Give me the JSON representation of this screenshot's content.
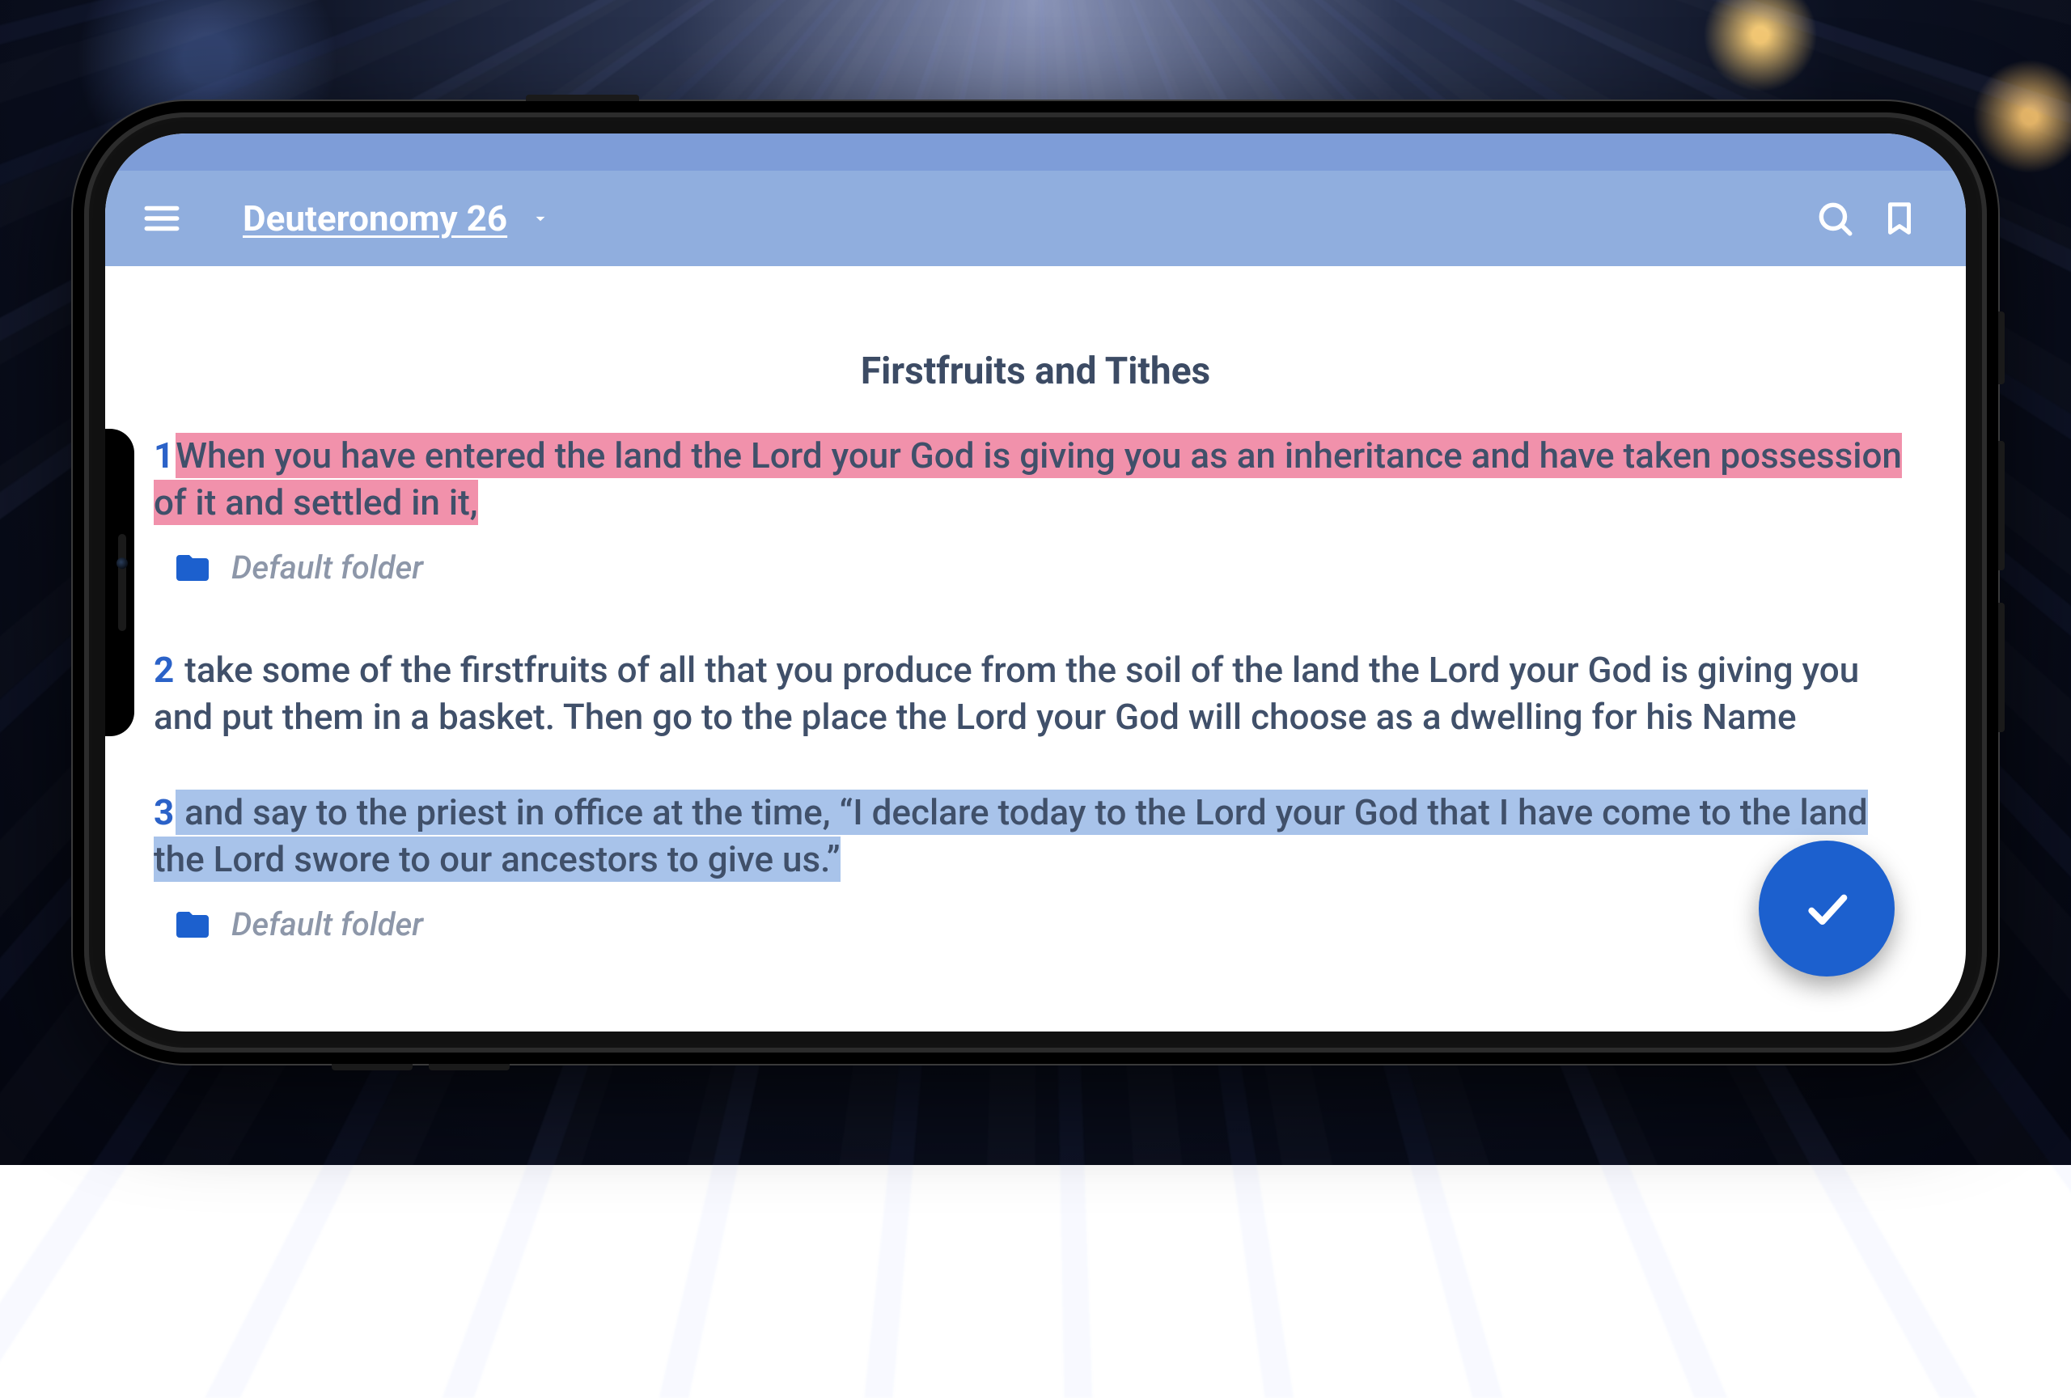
{
  "appbar": {
    "title": "Deuteronomy 26"
  },
  "section_title": "Firstfruits and Tithes",
  "verses": [
    {
      "num": "1",
      "text": "When you have entered the land the Lord your God is giving you as an inheritance and have taken possession of it and settled in it, ",
      "highlight": "pink",
      "folder_label": "Default folder"
    },
    {
      "num": "2",
      "text": " take some of the firstfruits of all that you produce from the soil of the land the Lord your God is giving you and put them in a basket. Then go to the place the Lord your God will choose as a dwelling for his Name",
      "highlight": null,
      "folder_label": null
    },
    {
      "num": "3",
      "text": " and say to the priest in office at the time, “I declare today to the Lord your God that I have come to the land the Lord swore to our ancestors to give us.” ",
      "highlight": "blue",
      "folder_label": "Default folder"
    }
  ],
  "colors": {
    "appbar_dark": "#7e9dd8",
    "appbar": "#90aede",
    "fab": "#1c60ce",
    "folder_icon": "#1c60ce",
    "highlight_pink": "#f191ab",
    "highlight_blue": "#a8c3ea",
    "text": "#40506a"
  }
}
